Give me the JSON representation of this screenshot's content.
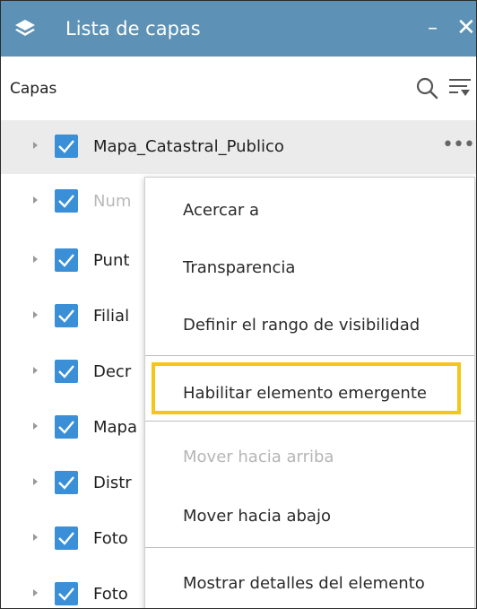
{
  "window": {
    "title": "Lista de capas",
    "minimize_label": "–",
    "close_label": "✕"
  },
  "toolbar": {
    "section_label": "Capas"
  },
  "icons": {
    "title": "layers-icon",
    "search": "search-icon",
    "filter": "filter-icon"
  },
  "colors": {
    "titlebar": "#5d91b5",
    "checkbox": "#3a8fd6",
    "focus": "#f5c518"
  },
  "layers": [
    {
      "label": "Mapa_Catastral_Publico",
      "checked": true,
      "highlighted": true,
      "dimmed": false
    },
    {
      "label": "Num",
      "checked": true,
      "highlighted": false,
      "dimmed": true
    },
    {
      "label": "Punt",
      "checked": true,
      "highlighted": false,
      "dimmed": false
    },
    {
      "label": "Filial",
      "checked": true,
      "highlighted": false,
      "dimmed": false
    },
    {
      "label": "Decr",
      "checked": true,
      "highlighted": false,
      "dimmed": false
    },
    {
      "label": "Mapa",
      "checked": true,
      "highlighted": false,
      "dimmed": false
    },
    {
      "label": "Distr",
      "checked": true,
      "highlighted": false,
      "dimmed": false
    },
    {
      "label": "Foto",
      "checked": true,
      "highlighted": false,
      "dimmed": false
    },
    {
      "label": "Foto",
      "checked": true,
      "highlighted": false,
      "dimmed": false
    }
  ],
  "more_label": "•••",
  "context_menu": {
    "items": [
      {
        "label": "Acercar a",
        "disabled": false
      },
      {
        "label": "Transparencia",
        "disabled": false
      },
      {
        "label": "Definir el rango de visibilidad",
        "disabled": false
      },
      {
        "label": "Habilitar elemento emergente",
        "disabled": false,
        "focused": true
      },
      {
        "label": "Mover hacia arriba",
        "disabled": true
      },
      {
        "label": "Mover hacia abajo",
        "disabled": false
      },
      {
        "label": "Mostrar detalles del elemento",
        "disabled": false
      }
    ]
  }
}
